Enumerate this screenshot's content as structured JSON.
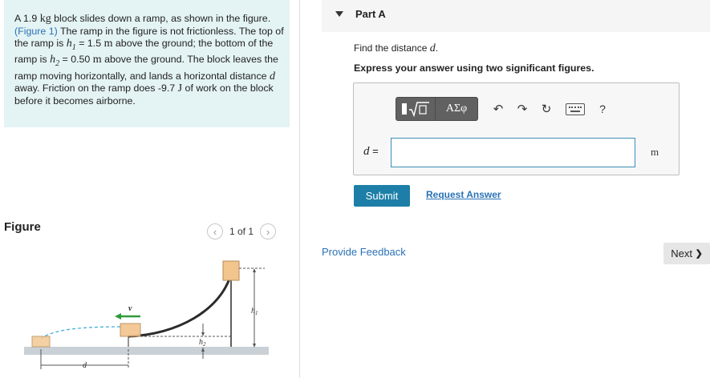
{
  "problem": {
    "mass": "A 1.9",
    "kg": "kg",
    "t1": "block slides down a ramp, as shown in the figure.",
    "figure_link": "(Figure 1)",
    "t2": "The ramp in the figure is not frictionless. The top of the ramp is",
    "h1": "h",
    "h1_sub": "1",
    "h1_val": "= 1.5",
    "m1": "m",
    "t3": "above the ground; the bottom of the ramp is",
    "h2": "h",
    "h2_sub": "2",
    "h2_val": "= 0.50",
    "m2": "m",
    "t4": "above the ground. The block leaves the ramp moving horizontally, and lands a horizontal distance",
    "d": "d",
    "t5": "away. Friction on the ramp does -9.7",
    "J": "J",
    "t6": "of work on the block before it becomes airborne."
  },
  "figure_panel": {
    "title": "Figure",
    "pager_text": "1 of 1",
    "labels": {
      "v": "v",
      "h1": "h",
      "h1_sub": "1",
      "h2": "h",
      "h2_sub": "2",
      "d": "d"
    }
  },
  "part": {
    "title": "Part A",
    "find_prefix": "Find the distance",
    "find_var": "d",
    "find_suffix": ".",
    "instruction": "Express your answer using two significant figures.",
    "toolbar": {
      "greek_label": "ΑΣφ",
      "help_label": "?"
    },
    "answer": {
      "var": "d",
      "eq": "=",
      "value": "",
      "unit": "m"
    },
    "submit_label": "Submit",
    "request_label": "Request Answer"
  },
  "footer": {
    "feedback_label": "Provide Feedback",
    "next_label": "Next",
    "next_arrow": "❯"
  },
  "colors": {
    "problem_bg": "#e4f3f4",
    "link": "#2a72b5",
    "submit_bg": "#1d7fa7",
    "arrow_green": "#2e9a3a"
  }
}
